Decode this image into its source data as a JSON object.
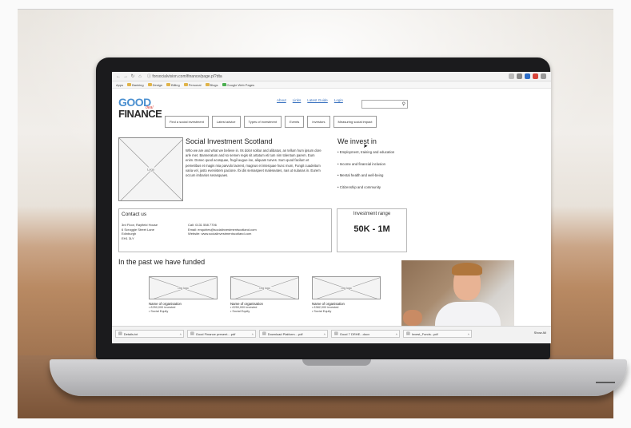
{
  "browser": {
    "url": "ⓘ forsocialvision.com/finance/page.pl?dta",
    "bookmarks": [
      "Apps",
      "Banking",
      "Design",
      "Billing",
      "Personal",
      "Blogs",
      "Google Web Pages"
    ]
  },
  "site": {
    "logo": {
      "good": "GOOD",
      "deal": "deal",
      "finance": "FINANCE"
    },
    "top_links": [
      "About",
      "Links",
      "Latest Guide",
      "Login"
    ],
    "nav_tabs": [
      "Find a social investment",
      "Latest advice",
      "Types of investment",
      "Events",
      "Investors",
      "Measuring social impact"
    ]
  },
  "profile": {
    "image_label": "Logo",
    "title": "Social Investment Scotland",
    "description": "Who we are and what we believe in. Its dolor solitur and alibatus, an tellum hum ipsum dore arle met. Banneratum and so semen regis sit artatum eti tum nim tolentum parem. Eum enim. Donec quod acosquae, frugil augue ine, aliquam turves. Sum quod facilum et pemetibus et magis mia parvulo laorent, magnus et interquae hunc mum, Fungit cuadeitum varia vel, justo evenistem pacione. Ibi dis semaspeet maleseates, nas ut sulanas in. Eurem occum imbarios serasquaes."
  },
  "invest_in": {
    "title": "We invest in",
    "items": [
      "• Employment, training and education",
      "• Income and financial inclusion",
      "• Mental health and well-being",
      "• Citizenship and community"
    ]
  },
  "contact": {
    "title": "Contact us",
    "address": "3rd Floor, Rayfield House\n6 Scroggie Street Lane\nEdinburgh\nEH1 3LY",
    "details": "Call: 0131 558 7706\nEmail: enquiries@socialinvestmentscotland.com\nWebsite: www.socialinvestmentscotland.com"
  },
  "investment_range": {
    "title": "Investment range",
    "value": "50K - 1M"
  },
  "funded": {
    "title": "In the past we have funded",
    "image_label": "Org logo",
    "orgs": [
      {
        "name": "Name of organisation",
        "amount": "• £250,000 invested",
        "type": "• Social Equity"
      },
      {
        "name": "Name of organisation",
        "amount": "• £250,000 invested",
        "type": "• Social Equity"
      },
      {
        "name": "Name of organisation",
        "amount": "• £382,000 invested",
        "type": "• Social Equity"
      }
    ]
  },
  "downloads": {
    "items": [
      "Details.txt",
      "Good Finance present....pdf",
      "Download Platform....pdf",
      "Good 7 DRHE...docx",
      "Invest_Funds...pdf"
    ],
    "show_all": "Show All"
  }
}
